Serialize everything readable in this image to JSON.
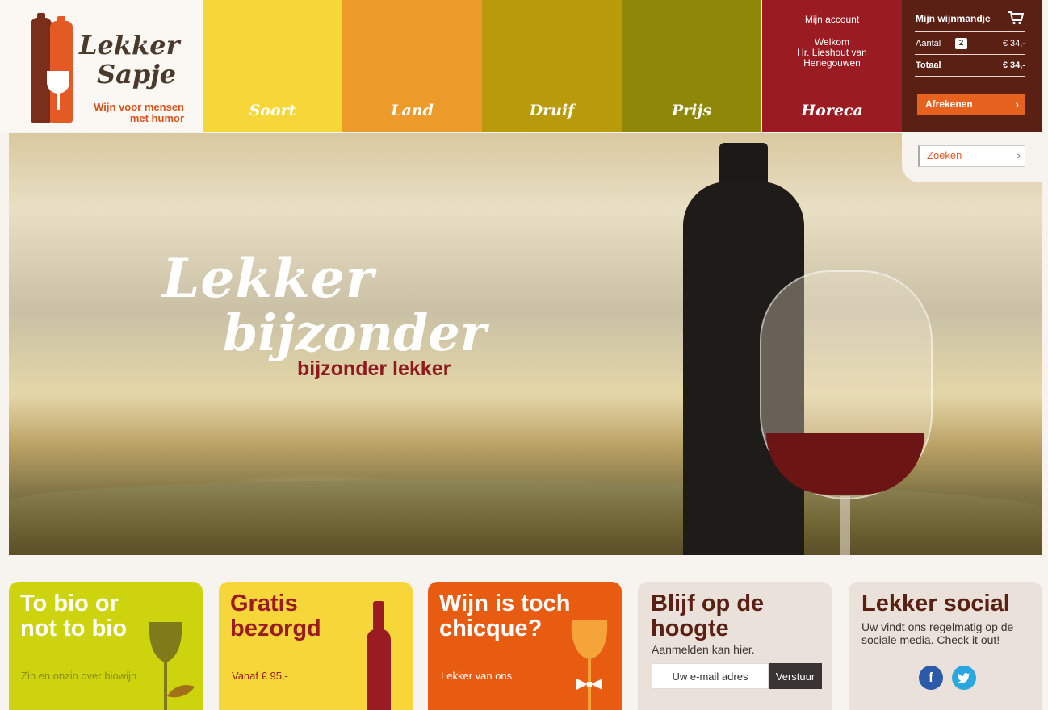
{
  "brand": {
    "name_line1": "Lekker",
    "name_line2": "Sapje",
    "tagline": "Wijn voor mensen met humor"
  },
  "nav": {
    "items": [
      {
        "label": "Soort",
        "color": "#f7d63a"
      },
      {
        "label": "Land",
        "color": "#ec9a2a"
      },
      {
        "label": "Druif",
        "color": "#b99a0b"
      },
      {
        "label": "Prijs",
        "color": "#8e8708"
      },
      {
        "label": "Horeca",
        "color": "#9b1b22"
      }
    ]
  },
  "account": {
    "link": "Mijn account",
    "welcome": "Welkom",
    "user_name": "Hr. Lieshout van Henegouwen"
  },
  "cart": {
    "title": "Mijn wijnmandje",
    "icon": "cart-icon",
    "count_label": "Aantal",
    "count": "2",
    "count_price": "€ 34,-",
    "total_label": "Totaal",
    "total_price": "€ 34,-",
    "checkout_label": "Afrekenen"
  },
  "search": {
    "placeholder": "Zoeken"
  },
  "hero": {
    "headline_line1": "Lekker",
    "headline_line2": "bijzonder",
    "subline": "bijzonder lekker"
  },
  "tiles": [
    {
      "title_line1": "To bio or",
      "title_line2": "not to bio",
      "subtitle": "Zin en onzin over biowijn",
      "color": "#cdd30c"
    },
    {
      "title_line1": "Gratis",
      "title_line2": "bezorgd",
      "subtitle": "Vanaf € 95,-",
      "color": "#f7d63a"
    },
    {
      "title_line1": "Wijn is toch",
      "title_line2": "chicque?",
      "subtitle": "Lekker van ons",
      "color": "#e85c12"
    },
    {
      "title_line1": "Blijf op de",
      "title_line2": "hoogte",
      "subtitle": "Aanmelden kan hier.",
      "email_placeholder": "Uw e-mail adres",
      "submit_label": "Verstuur",
      "color": "#e9e1da"
    },
    {
      "title_line1": "Lekker social",
      "subtitle": "Uw vindt ons regelmatig op de sociale media. Check it out!",
      "facebook": "f",
      "color": "#e9e1da"
    }
  ]
}
